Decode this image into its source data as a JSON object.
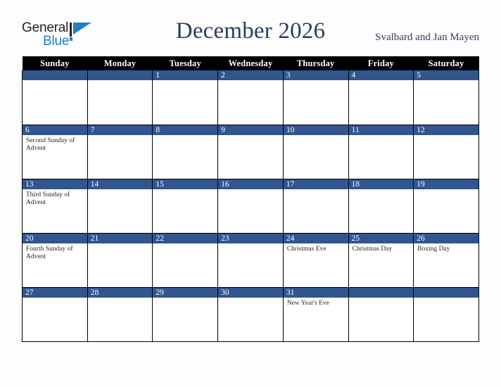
{
  "logo": {
    "word_one": "General",
    "word_two": "Blue",
    "mark": "blue-triangle-flag",
    "accent_color": "#1f7fc4"
  },
  "header": {
    "title": "December 2026",
    "region": "Svalbard and Jan Mayen",
    "title_color": "#2b3d63"
  },
  "calendar": {
    "weekday_headers": [
      "Sunday",
      "Monday",
      "Tuesday",
      "Wednesday",
      "Thursday",
      "Friday",
      "Saturday"
    ],
    "header_bg": "#000000",
    "daynum_bg": "#31568f",
    "weeks": [
      [
        {
          "day": "",
          "event": ""
        },
        {
          "day": "",
          "event": ""
        },
        {
          "day": "1",
          "event": ""
        },
        {
          "day": "2",
          "event": ""
        },
        {
          "day": "3",
          "event": ""
        },
        {
          "day": "4",
          "event": ""
        },
        {
          "day": "5",
          "event": ""
        }
      ],
      [
        {
          "day": "6",
          "event": "Second Sunday of Advent"
        },
        {
          "day": "7",
          "event": ""
        },
        {
          "day": "8",
          "event": ""
        },
        {
          "day": "9",
          "event": ""
        },
        {
          "day": "10",
          "event": ""
        },
        {
          "day": "11",
          "event": ""
        },
        {
          "day": "12",
          "event": ""
        }
      ],
      [
        {
          "day": "13",
          "event": "Third Sunday of Advent"
        },
        {
          "day": "14",
          "event": ""
        },
        {
          "day": "15",
          "event": ""
        },
        {
          "day": "16",
          "event": ""
        },
        {
          "day": "17",
          "event": ""
        },
        {
          "day": "18",
          "event": ""
        },
        {
          "day": "19",
          "event": ""
        }
      ],
      [
        {
          "day": "20",
          "event": "Fourth Sunday of Advent"
        },
        {
          "day": "21",
          "event": ""
        },
        {
          "day": "22",
          "event": ""
        },
        {
          "day": "23",
          "event": ""
        },
        {
          "day": "24",
          "event": "Christmas Eve"
        },
        {
          "day": "25",
          "event": "Christmas Day"
        },
        {
          "day": "26",
          "event": "Boxing Day"
        }
      ],
      [
        {
          "day": "27",
          "event": ""
        },
        {
          "day": "28",
          "event": ""
        },
        {
          "day": "29",
          "event": ""
        },
        {
          "day": "30",
          "event": ""
        },
        {
          "day": "31",
          "event": "New Year's Eve"
        },
        {
          "day": "",
          "event": ""
        },
        {
          "day": "",
          "event": ""
        }
      ]
    ]
  }
}
